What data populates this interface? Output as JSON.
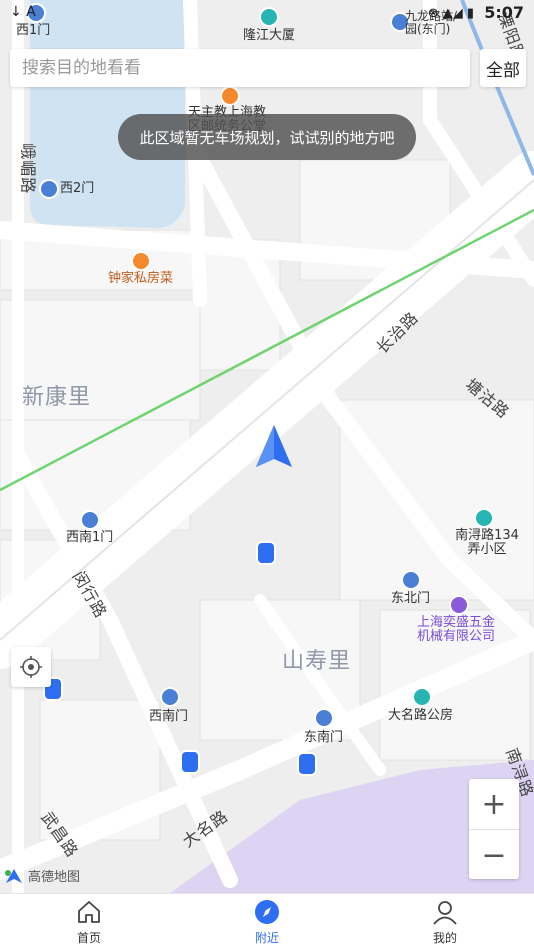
{
  "status_bar": {
    "time": "5:07",
    "left_icons": "↓ A",
    "right_icons": "⊗ ▲◢ ▮"
  },
  "search": {
    "placeholder": "搜索目的地看看",
    "filter_label": "全部"
  },
  "toast": {
    "message": "此区域暂无车场规划，试试别的地方吧"
  },
  "map": {
    "districts": [
      "新康里",
      "山寿里"
    ],
    "streets": [
      "长治路",
      "塘沽路",
      "闵行路",
      "武昌路",
      "大名路",
      "南浔路",
      "峨嵋路",
      "溧阳路"
    ],
    "pois": [
      {
        "name": "西1门",
        "kind": "entrance"
      },
      {
        "name": "隆江大厦",
        "kind": "building"
      },
      {
        "name": "九龙路站/园(东门)",
        "kind": "entrance"
      },
      {
        "name": "天主教上海教区邮统务公堂",
        "kind": "food"
      },
      {
        "name": "西2门",
        "kind": "entrance"
      },
      {
        "name": "钟家私房菜",
        "kind": "food"
      },
      {
        "name": "西南1门",
        "kind": "entrance"
      },
      {
        "name": "南浔路134弄小区",
        "kind": "building"
      },
      {
        "name": "东北门",
        "kind": "entrance"
      },
      {
        "name": "上海奕盛五金机械有限公司",
        "kind": "company"
      },
      {
        "name": "西南门",
        "kind": "entrance"
      },
      {
        "name": "东南门",
        "kind": "entrance"
      },
      {
        "name": "大名路公房",
        "kind": "building"
      }
    ],
    "brand": "高德地图",
    "zoom_in": "+",
    "zoom_out": "−"
  },
  "tabs": [
    {
      "label": "首页",
      "icon": "home-icon",
      "active": false
    },
    {
      "label": "附近",
      "icon": "compass-icon",
      "active": true
    },
    {
      "label": "我的",
      "icon": "user-icon",
      "active": false
    }
  ],
  "colors": {
    "accent": "#2e6ff2",
    "water": "#cfe3f2",
    "green_line": "#5ac85a",
    "park": "#d9d0f0"
  }
}
